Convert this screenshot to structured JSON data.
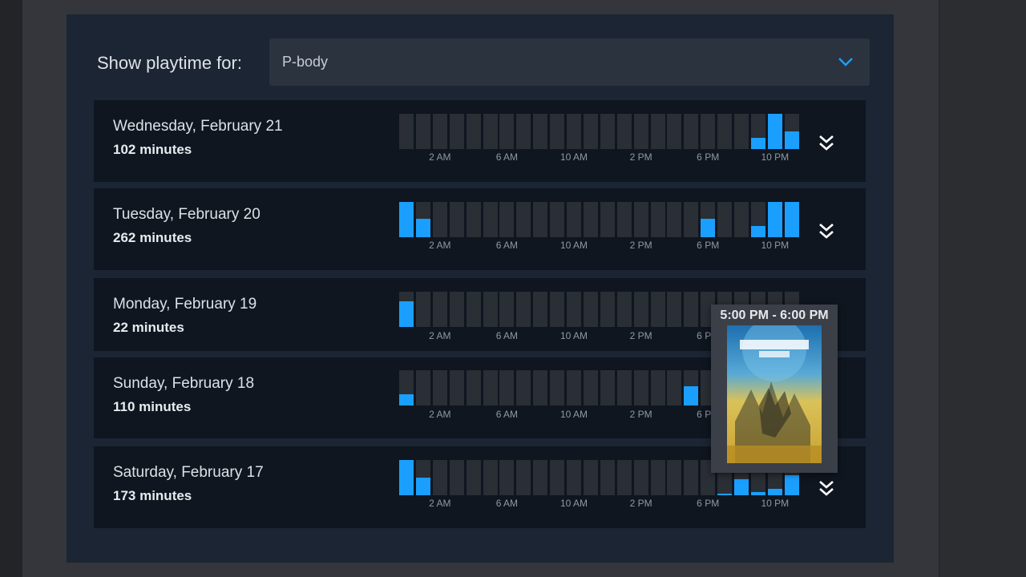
{
  "filter": {
    "label": "Show playtime for:",
    "selected": "P-body"
  },
  "axis_ticks": [
    "2 AM",
    "6 AM",
    "10 AM",
    "2 PM",
    "6 PM",
    "10 PM"
  ],
  "colors": {
    "bar_active": "#1a9fff",
    "bar_empty": "#2a2e35",
    "accent": "#1a9fff"
  },
  "days": [
    {
      "date": "Wednesday, February 21",
      "minutes": "102 minutes",
      "hourly_fraction": [
        0,
        0,
        0,
        0,
        0,
        0,
        0,
        0,
        0,
        0,
        0,
        0,
        0,
        0,
        0,
        0,
        0,
        0,
        0,
        0,
        0,
        0.32,
        1.0,
        0.5
      ]
    },
    {
      "date": "Tuesday, February 20",
      "minutes": "262 minutes",
      "hourly_fraction": [
        1.0,
        0.52,
        0,
        0,
        0,
        0,
        0,
        0,
        0,
        0,
        0,
        0,
        0,
        0,
        0,
        0,
        0,
        0,
        0.52,
        0,
        0,
        0.32,
        1.0,
        1.0
      ]
    },
    {
      "date": "Monday, February 19",
      "minutes": "22 minutes",
      "hourly_fraction": [
        0.72,
        0,
        0,
        0,
        0,
        0,
        0,
        0,
        0,
        0,
        0,
        0,
        0,
        0,
        0,
        0,
        0,
        0,
        0,
        0,
        0,
        0,
        0,
        0
      ]
    },
    {
      "date": "Sunday, February 18",
      "minutes": "110 minutes",
      "hourly_fraction": [
        0.32,
        0,
        0,
        0,
        0,
        0,
        0,
        0,
        0,
        0,
        0,
        0,
        0,
        0,
        0,
        0,
        0,
        0.55,
        0,
        0,
        0,
        0,
        0,
        0
      ]
    },
    {
      "date": "Saturday, February 17",
      "minutes": "173 minutes",
      "hourly_fraction": [
        1.0,
        0.5,
        0,
        0,
        0,
        0,
        0,
        0,
        0,
        0,
        0,
        0,
        0,
        0,
        0,
        0,
        0,
        0,
        0,
        0.05,
        0.45,
        0.1,
        0.18,
        0.57
      ]
    }
  ],
  "tooltip": {
    "time_range": "5:00 PM - 6:00 PM",
    "game_icon": "helldivers-2-cover"
  }
}
